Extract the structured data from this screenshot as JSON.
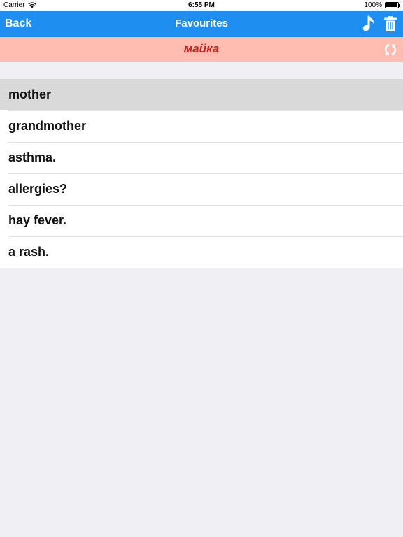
{
  "status_bar": {
    "carrier": "Carrier",
    "time": "6:55 PM",
    "battery": "100%",
    "battery_level": 1.0
  },
  "nav": {
    "back_label": "Back",
    "title": "Favourites",
    "music_icon": "music-note-icon",
    "trash_icon": "trash-icon"
  },
  "word_bar": {
    "word": "майка",
    "swap_icon": "swap-icon"
  },
  "items": [
    {
      "label": "mother",
      "selected": true
    },
    {
      "label": "grandmother",
      "selected": false
    },
    {
      "label": "asthma.",
      "selected": false
    },
    {
      "label": "allergies?",
      "selected": false
    },
    {
      "label": "hay fever.",
      "selected": false
    },
    {
      "label": "a rash.",
      "selected": false
    }
  ],
  "colors": {
    "nav_bg": "#1f8ef1",
    "word_bar_bg": "#ffbcb0",
    "word_color": "#c3251d",
    "selected_row": "#d9d9d9",
    "page_bg": "#efeff4"
  }
}
